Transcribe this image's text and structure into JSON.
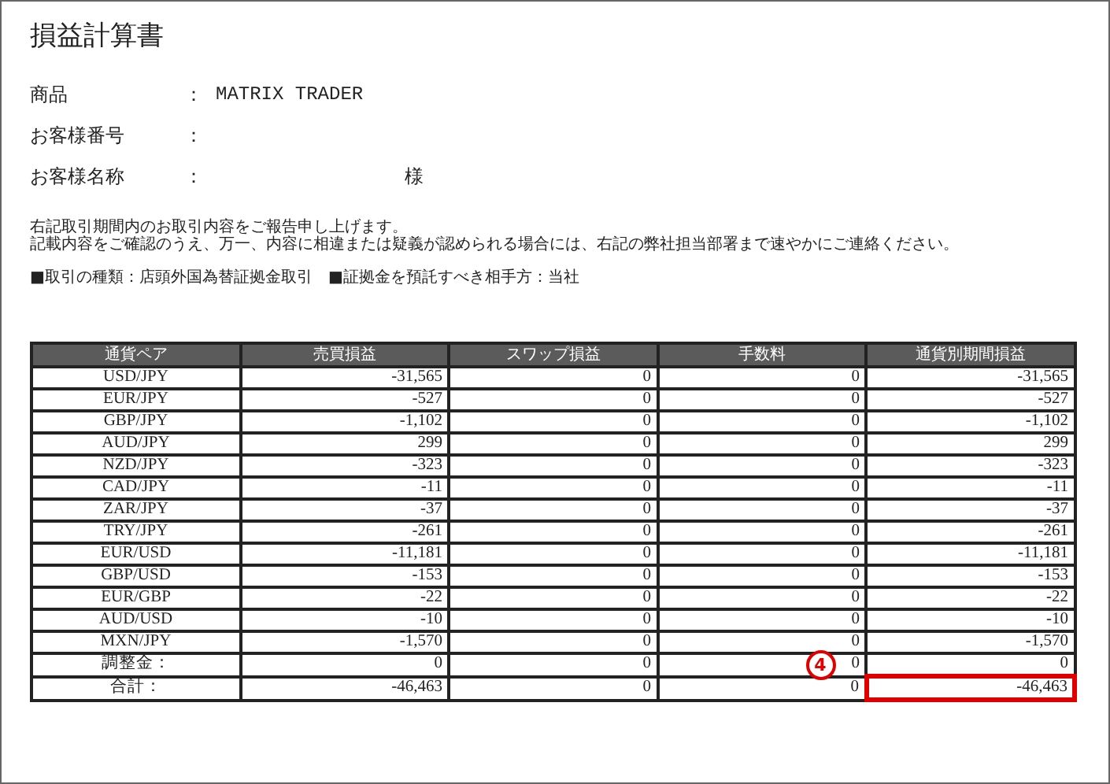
{
  "title": "損益計算書",
  "info": [
    {
      "label": "商品",
      "colon": "：",
      "value": "MATRIX TRADER"
    },
    {
      "label": "お客様番号",
      "colon": "："
    },
    {
      "label": "お客様名称",
      "colon": "：",
      "suffix": "様"
    }
  ],
  "notes": [
    "右記取引期間内のお取引内容をご報告申し上げます。",
    "記載内容をご確認のうえ、万一、内容に相違または疑義が認められる場合には、右記の弊社担当部署まで速やかにご連絡ください。"
  ],
  "terms": [
    "■取引の種類：店頭外国為替証拠金取引",
    "■証拠金を預託すべき相手方：当社"
  ],
  "table": {
    "columns": [
      "通貨ペア",
      "売買損益",
      "スワップ損益",
      "手数料",
      "通貨別期間損益"
    ],
    "rows": [
      {
        "cells": [
          "USD/JPY",
          "-31,565",
          "0",
          "0",
          "-31,565"
        ],
        "highlighted": false
      },
      {
        "cells": [
          "EUR/JPY",
          "-527",
          "0",
          "0",
          "-527"
        ],
        "highlighted": false
      },
      {
        "cells": [
          "GBP/JPY",
          "-1,102",
          "0",
          "0",
          "-1,102"
        ],
        "highlighted": false
      },
      {
        "cells": [
          "AUD/JPY",
          "299",
          "0",
          "0",
          "299"
        ],
        "highlighted": false
      },
      {
        "cells": [
          "NZD/JPY",
          "-323",
          "0",
          "0",
          "-323"
        ],
        "highlighted": false
      },
      {
        "cells": [
          "CAD/JPY",
          "-11",
          "0",
          "0",
          "-11"
        ],
        "highlighted": false
      },
      {
        "cells": [
          "ZAR/JPY",
          "-37",
          "0",
          "0",
          "-37"
        ],
        "highlighted": false
      },
      {
        "cells": [
          "TRY/JPY",
          "-261",
          "0",
          "0",
          "-261"
        ],
        "highlighted": false
      },
      {
        "cells": [
          "EUR/USD",
          "-11,181",
          "0",
          "0",
          "-11,181"
        ],
        "highlighted": false
      },
      {
        "cells": [
          "GBP/USD",
          "-153",
          "0",
          "0",
          "-153"
        ],
        "highlighted": false
      },
      {
        "cells": [
          "EUR/GBP",
          "-22",
          "0",
          "0",
          "-22"
        ],
        "highlighted": false
      },
      {
        "cells": [
          "AUD/USD",
          "-10",
          "0",
          "0",
          "-10"
        ],
        "highlighted": false
      },
      {
        "cells": [
          "MXN/JPY",
          "-1,570",
          "0",
          "0",
          "-1,570"
        ],
        "highlighted": false
      },
      {
        "cells": [
          "調整金：",
          "0",
          "0",
          "0",
          "0"
        ],
        "highlighted": false
      },
      {
        "cells": [
          "合計：",
          "-46,463",
          "0",
          "0",
          "-46,463"
        ],
        "highlighted": true,
        "callout": "4"
      }
    ]
  }
}
